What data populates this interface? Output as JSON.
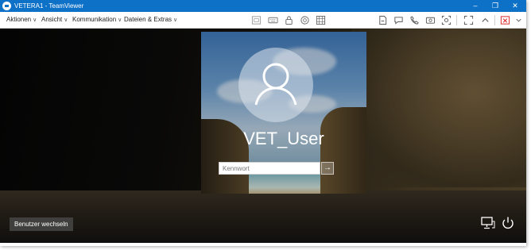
{
  "window": {
    "title": "VETERA1 - TeamViewer",
    "controls": [
      "–",
      "❐",
      "✕"
    ]
  },
  "menu": [
    {
      "label": "Aktionen"
    },
    {
      "label": "Ansicht"
    },
    {
      "label": "Kommunikation"
    },
    {
      "label": "Dateien & Extras"
    }
  ],
  "chevron": "∨",
  "lockscreen": {
    "username": "VET_User",
    "password_placeholder": "Kennwort",
    "submit_glyph": "→",
    "switch_user_label": "Benutzer wechseln"
  }
}
